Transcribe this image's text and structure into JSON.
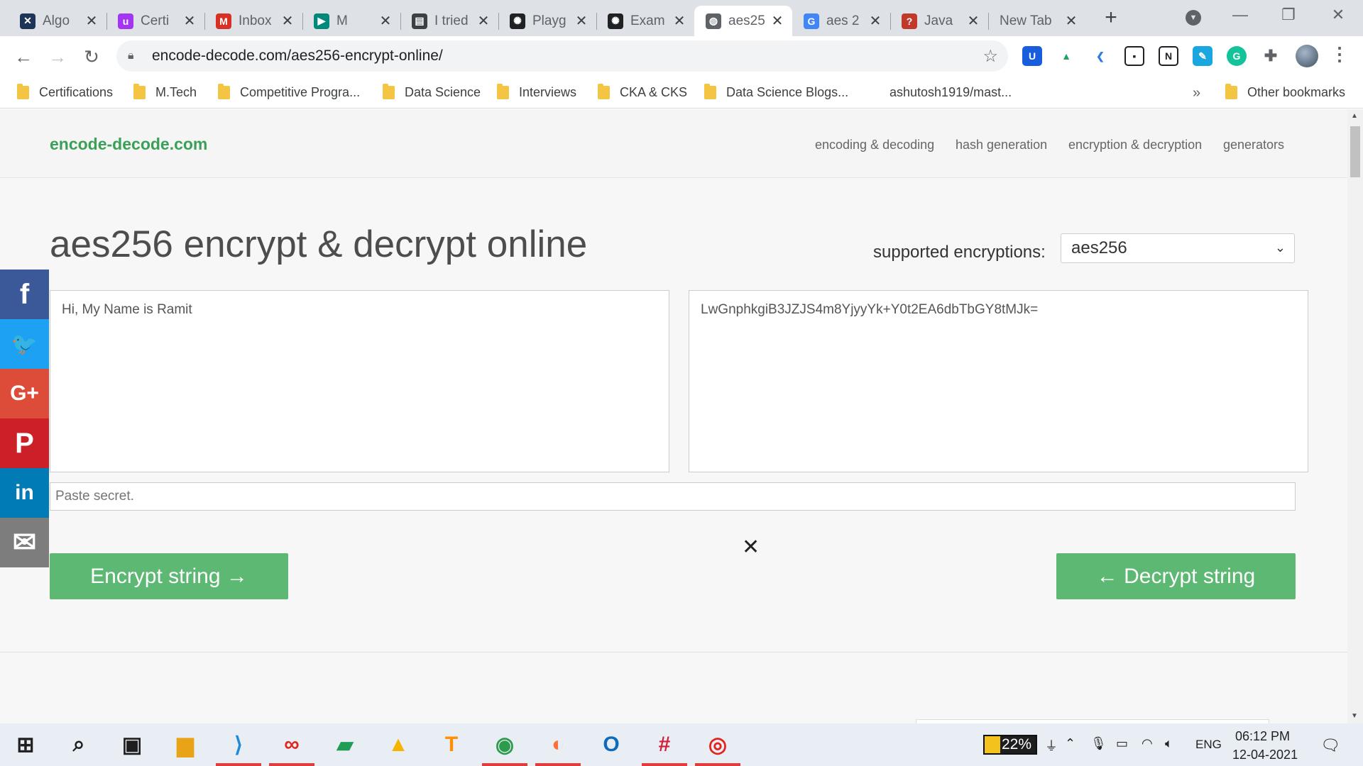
{
  "browser": {
    "tabs": [
      {
        "title": "Algo",
        "favicon": "algoexpert-icon",
        "color": "#1d3557",
        "glyph": "✕"
      },
      {
        "title": "Certi",
        "favicon": "udemy-icon",
        "color": "#a435f0",
        "glyph": "u"
      },
      {
        "title": "Inbox",
        "favicon": "gmail-icon",
        "color": "#d93025",
        "glyph": "M"
      },
      {
        "title": "M",
        "favicon": "google-meet-icon",
        "color": "#00897b",
        "glyph": "▶"
      },
      {
        "title": "I tried",
        "favicon": "document-icon",
        "color": "#3c4043",
        "glyph": "▤"
      },
      {
        "title": "Playg",
        "favicon": "openai-icon",
        "color": "#202123",
        "glyph": "✺"
      },
      {
        "title": "Exam",
        "favicon": "openai-icon",
        "color": "#202123",
        "glyph": "✺"
      },
      {
        "title": "aes25",
        "favicon": "globe-icon",
        "color": "#5f6368",
        "glyph": "◍"
      },
      {
        "title": "aes 2",
        "favicon": "google-icon",
        "color": "#4285f4",
        "glyph": "G"
      },
      {
        "title": "Java",
        "favicon": "question-icon",
        "color": "#c0392b",
        "glyph": "?"
      },
      {
        "title": "New Tab",
        "favicon": "",
        "color": "",
        "glyph": ""
      }
    ],
    "active_tab": 7,
    "url": "encode-decode.com/aes256-encrypt-online/",
    "bookmarks": [
      "Certifications",
      "M.Tech",
      "Competitive Progra...",
      "Data Science",
      "Interviews",
      "CKA & CKS",
      "Data Science Blogs...",
      "ashutosh1919/mast..."
    ],
    "other_bookmarks": "Other bookmarks",
    "bookmarks_overflow": "»"
  },
  "site": {
    "logo": "encode-decode.com",
    "nav": [
      "encoding & decoding",
      "hash generation",
      "encryption & decryption",
      "generators"
    ],
    "page_title": "aes256 encrypt & decrypt online",
    "supported_label": "supported encryptions:",
    "selected_encryption": "aes256",
    "plaintext": "Hi, My Name is Ramit",
    "ciphertext": "LwGnphkgiB3JZJS4m8YjyyYk+Y0t2EA6dbTbGY8tMJk=",
    "secret_placeholder": "Paste secret.",
    "encrypt_label": "Encrypt string →",
    "decrypt_label": "← Decrypt string",
    "clear_symbol": "✕"
  },
  "share": [
    {
      "name": "facebook-icon",
      "glyph": "f",
      "color": "#3b5998"
    },
    {
      "name": "twitter-icon",
      "glyph": "🐦",
      "color": "#1da1f2"
    },
    {
      "name": "google-plus-icon",
      "glyph": "G+",
      "color": "#dd4b39"
    },
    {
      "name": "pinterest-icon",
      "glyph": "P",
      "color": "#cb2027"
    },
    {
      "name": "linkedin-icon",
      "glyph": "in",
      "color": "#007bb5"
    },
    {
      "name": "email-icon",
      "glyph": "✉",
      "color": "#7d7d7d"
    }
  ],
  "taskbar": {
    "apps": [
      {
        "name": "windows-start-icon",
        "color": "#1e1e1e",
        "glyph": "⊞"
      },
      {
        "name": "search-icon",
        "color": "#1e1e1e",
        "glyph": "⌕"
      },
      {
        "name": "task-view-icon",
        "color": "#1e1e1e",
        "glyph": "▣"
      },
      {
        "name": "file-explorer-icon",
        "color": "#e8a317",
        "glyph": "▆"
      },
      {
        "name": "vscode-icon",
        "color": "#1f88d8",
        "glyph": "⟩"
      },
      {
        "name": "acrobat-icon",
        "color": "#e2241b",
        "glyph": "∞"
      },
      {
        "name": "google-chat-icon",
        "color": "#1f9d55",
        "glyph": "▰"
      },
      {
        "name": "google-drive-icon",
        "color": "#f4b400",
        "glyph": "▲"
      },
      {
        "name": "tensorflow-icon",
        "color": "#ff8f00",
        "glyph": "T"
      },
      {
        "name": "chrome-icon",
        "color": "#2d9b4d",
        "glyph": "◉"
      },
      {
        "name": "firefox-icon",
        "color": "#ff7139",
        "glyph": "◐"
      },
      {
        "name": "outlook-icon",
        "color": "#0f6cbd",
        "glyph": "O"
      },
      {
        "name": "slack-icon",
        "color": "#d41f3a",
        "glyph": "#"
      },
      {
        "name": "recorder-icon",
        "color": "#e2241b",
        "glyph": "◎"
      }
    ],
    "battery_percent": "22%",
    "language": "ENG",
    "time": "06:12 PM",
    "date": "12-04-2021"
  }
}
